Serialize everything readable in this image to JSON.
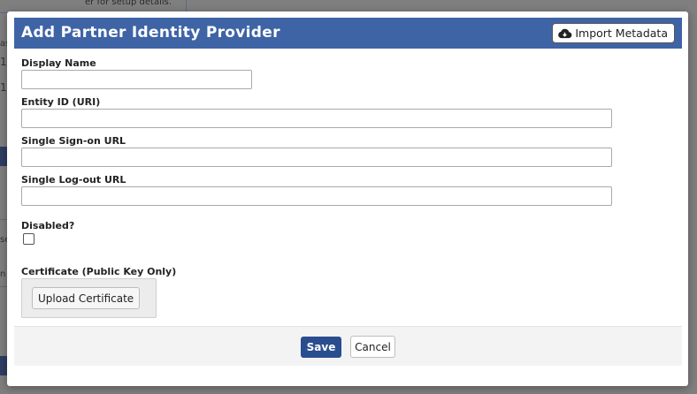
{
  "background": {
    "partial_texts": [
      "er for setup details.",
      "as",
      "1/",
      "1/",
      "se",
      "n"
    ]
  },
  "modal": {
    "title": "Add Partner Identity Provider",
    "import_button_label": "Import Metadata",
    "import_icon": "cloud-download-icon",
    "fields": {
      "display_name": {
        "label": "Display Name",
        "value": ""
      },
      "entity_id": {
        "label": "Entity ID (URI)",
        "value": ""
      },
      "sso_url": {
        "label": "Single Sign-on URL",
        "value": ""
      },
      "logout_url": {
        "label": "Single Log-out URL",
        "value": ""
      },
      "disabled": {
        "label": "Disabled?",
        "checked": false
      },
      "certificate": {
        "label": "Certificate (Public Key Only)",
        "upload_label": "Upload Certificate"
      }
    },
    "footer": {
      "save_label": "Save",
      "cancel_label": "Cancel"
    }
  },
  "colors": {
    "header": "#3e64a6",
    "primary_button": "#2a4d8f",
    "overlay": "#7f7f7f"
  }
}
